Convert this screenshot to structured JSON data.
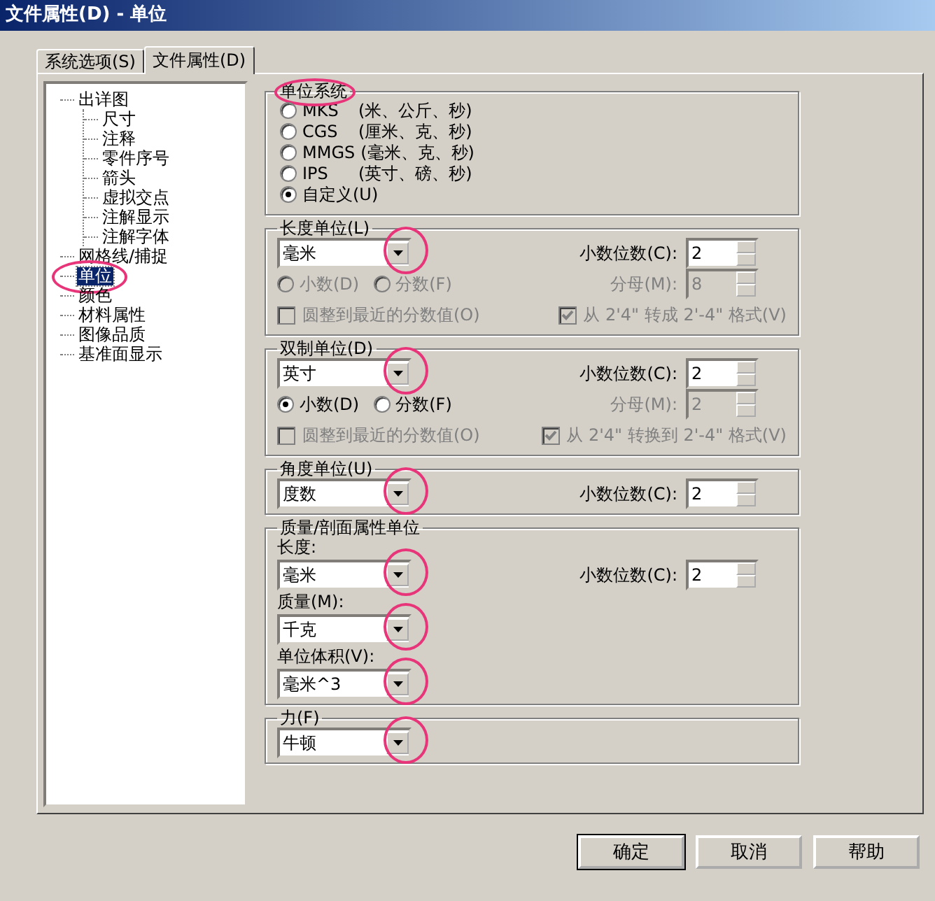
{
  "window": {
    "title": "文件属性(D) - 单位"
  },
  "tabs": [
    {
      "label": "系统选项(S)",
      "selected": false
    },
    {
      "label": "文件属性(D)",
      "selected": true
    }
  ],
  "tree": [
    {
      "label": "出详图",
      "selected": false,
      "circled": false,
      "children": [
        {
          "label": "尺寸",
          "selected": false,
          "circled": false
        },
        {
          "label": "注释",
          "selected": false,
          "circled": false
        },
        {
          "label": "零件序号",
          "selected": false,
          "circled": false
        },
        {
          "label": "箭头",
          "selected": false,
          "circled": false
        },
        {
          "label": "虚拟交点",
          "selected": false,
          "circled": false
        },
        {
          "label": "注解显示",
          "selected": false,
          "circled": false
        },
        {
          "label": "注解字体",
          "selected": false,
          "circled": false
        }
      ]
    },
    {
      "label": "网格线/捕捉",
      "selected": false,
      "circled": false
    },
    {
      "label": "单位",
      "selected": true,
      "circled": true
    },
    {
      "label": "颜色",
      "selected": false,
      "circled": false
    },
    {
      "label": "材料属性",
      "selected": false,
      "circled": false
    },
    {
      "label": "图像品质",
      "selected": false,
      "circled": false
    },
    {
      "label": "基准面显示",
      "selected": false,
      "circled": false
    }
  ],
  "units_system": {
    "title": "单位系统",
    "circled": true,
    "options": [
      {
        "code": "MKS",
        "desc": "(米、公斤、秒)",
        "selected": false
      },
      {
        "code": "CGS",
        "desc": "(厘米、克、秒)",
        "selected": false
      },
      {
        "code": "MMGS",
        "desc": "(毫米、克、秒)",
        "selected": false
      },
      {
        "code": "IPS",
        "desc": "(英寸、磅、秒)",
        "selected": false
      },
      {
        "code": "自定义(U)",
        "selected": true
      }
    ]
  },
  "unit_groups": [
    {
      "title": "长度单位(L)",
      "unit": "毫米",
      "circled": true,
      "decimals_label": "小数位数(C):",
      "decimals": "2",
      "radios": [
        {
          "label": "小数(D)",
          "selected": false,
          "disabled": true
        },
        {
          "label": "分数(F)",
          "selected": false,
          "disabled": true
        }
      ],
      "denominator_label": "分母(M):",
      "denominator": "8",
      "checks": [
        {
          "label": "圆整到最近的分数值(O)",
          "checked": false,
          "disabled": true
        },
        {
          "label": "从 2'4\" 转成 2'-4\" 格式(V)",
          "checked": true,
          "disabled": true
        }
      ]
    },
    {
      "title": "双制单位(D)",
      "unit": "英寸",
      "circled": true,
      "decimals_label": "小数位数(C):",
      "decimals": "2",
      "radios": [
        {
          "label": "小数(D)",
          "selected": true,
          "disabled": false
        },
        {
          "label": "分数(F)",
          "selected": false,
          "disabled": false
        }
      ],
      "denominator_label": "分母(M):",
      "denominator": "2",
      "checks": [
        {
          "label": "圆整到最近的分数值(O)",
          "checked": false,
          "disabled": true
        },
        {
          "label": "从 2'4\" 转换到 2'-4\" 格式(V)",
          "checked": true,
          "disabled": true
        }
      ]
    },
    {
      "title": "角度单位(U)",
      "unit": "度数",
      "circled": true,
      "decimals_label": "小数位数(C):",
      "decimals": "2"
    }
  ],
  "mass_units": {
    "title": "质量/剖面属性单位",
    "decimals_label": "小数位数(C):",
    "decimals": "2",
    "fields": [
      {
        "label": "长度:",
        "value": "毫米",
        "circled": true
      },
      {
        "label": "质量(M):",
        "value": "千克",
        "circled": true
      },
      {
        "label": "单位体积(V):",
        "value": "毫米^3",
        "circled": true
      }
    ]
  },
  "force_units": {
    "title": "力(F)",
    "value": "牛顿",
    "circled": true
  },
  "buttons": [
    {
      "label": "确定",
      "default": true
    },
    {
      "label": "取消",
      "default": false
    },
    {
      "label": "帮助",
      "default": false
    }
  ]
}
